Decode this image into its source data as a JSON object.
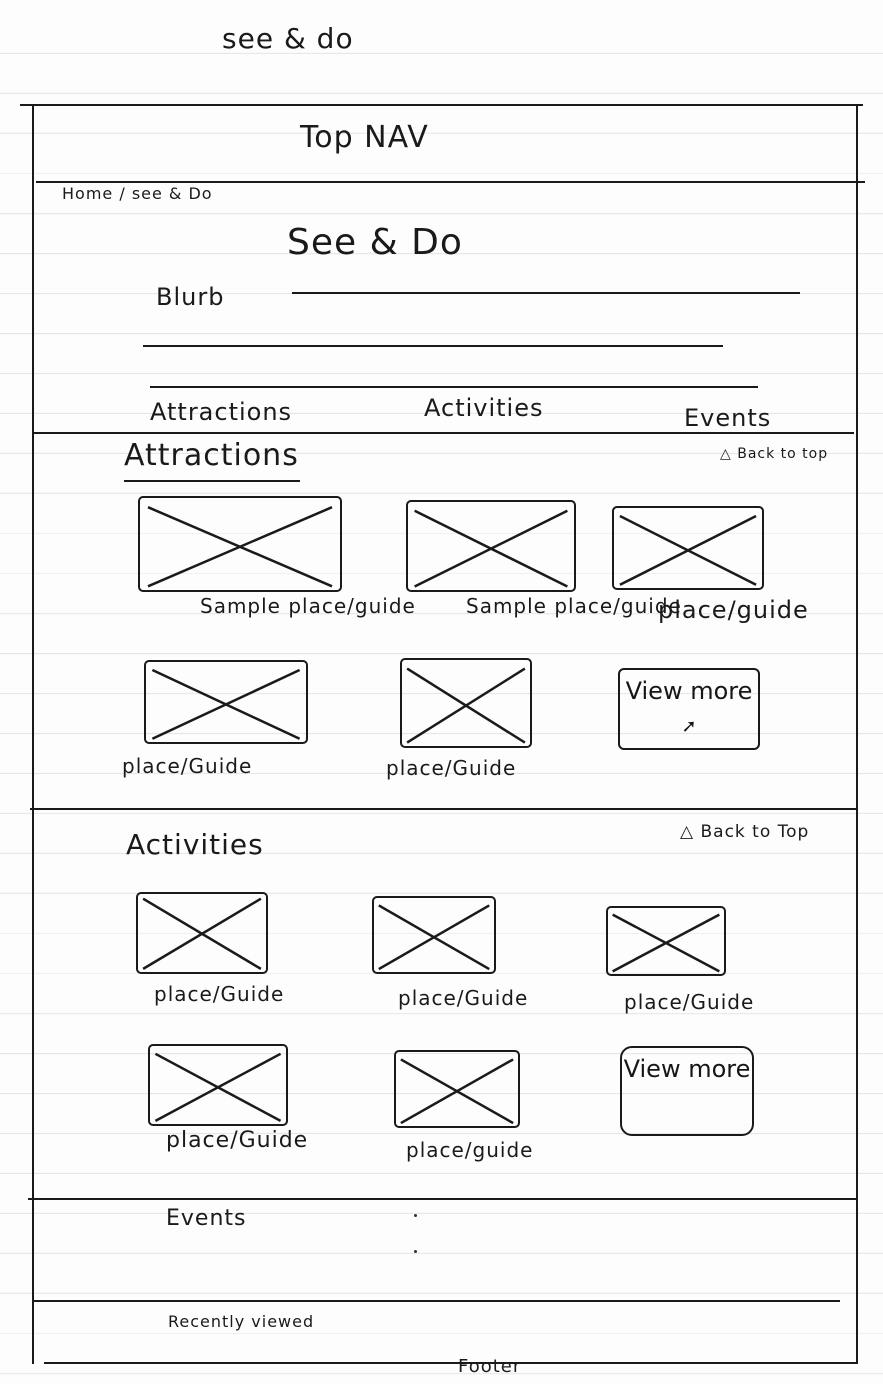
{
  "page_label": "see & do",
  "top_nav": "Top NAV",
  "breadcrumb": "Home / see & Do",
  "title": "See & Do",
  "blurb_label": "Blurb",
  "anchor_nav": {
    "attractions": "Attractions",
    "activities": "Activities",
    "events": "Events"
  },
  "attractions": {
    "heading": "Attractions",
    "back_to_top": "Back to top",
    "items": [
      {
        "caption": "Sample place/guide"
      },
      {
        "caption": "Sample place/guide"
      },
      {
        "caption": "place/guide"
      },
      {
        "caption": "place/Guide"
      },
      {
        "caption": "place/Guide"
      }
    ],
    "view_more": "View more"
  },
  "activities": {
    "heading": "Activities",
    "back_to_top": "Back to Top",
    "items": [
      {
        "caption": "place/Guide"
      },
      {
        "caption": "place/Guide"
      },
      {
        "caption": "place/Guide"
      },
      {
        "caption": "place/Guide"
      },
      {
        "caption": "place/guide"
      }
    ],
    "view_more": "View more"
  },
  "events": {
    "heading": "Events"
  },
  "recently_viewed": "Recently viewed",
  "footer": "Footer"
}
